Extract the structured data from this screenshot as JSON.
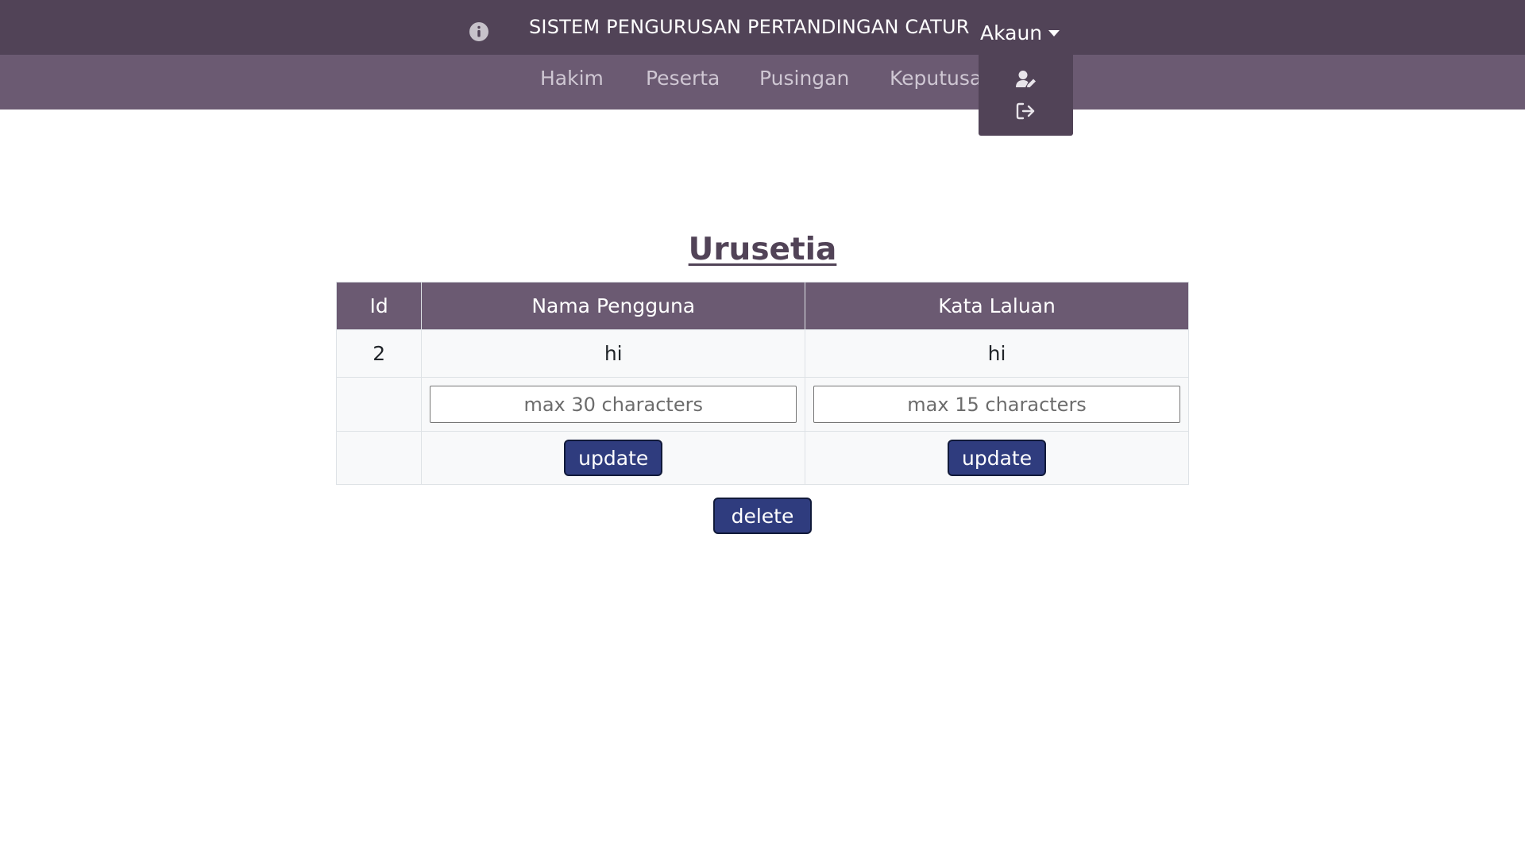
{
  "header": {
    "title": "SISTEM PENGURUSAN PERTANDINGAN CATUR",
    "info_icon": "info-circle-icon",
    "account_label": "Akaun"
  },
  "nav": {
    "items": [
      {
        "label": "Hakim"
      },
      {
        "label": "Peserta"
      },
      {
        "label": "Pusingan"
      },
      {
        "label": "Keputusan"
      }
    ]
  },
  "account_menu": {
    "items": [
      {
        "icon": "user-edit-icon"
      },
      {
        "icon": "sign-out-icon"
      }
    ]
  },
  "page": {
    "heading": "Urusetia"
  },
  "table": {
    "headers": [
      "Id",
      "Nama Pengguna",
      "Kata Laluan"
    ],
    "rows": [
      {
        "id": "2",
        "username": "hi",
        "password": "hi"
      }
    ],
    "username_placeholder": "max 30 characters",
    "password_placeholder": "max 15 characters",
    "update_label": "update"
  },
  "actions": {
    "delete_label": "delete"
  },
  "colors": {
    "header_bg": "#514357",
    "nav_bg": "#6b5a72",
    "button_bg": "#2f3c7e"
  }
}
